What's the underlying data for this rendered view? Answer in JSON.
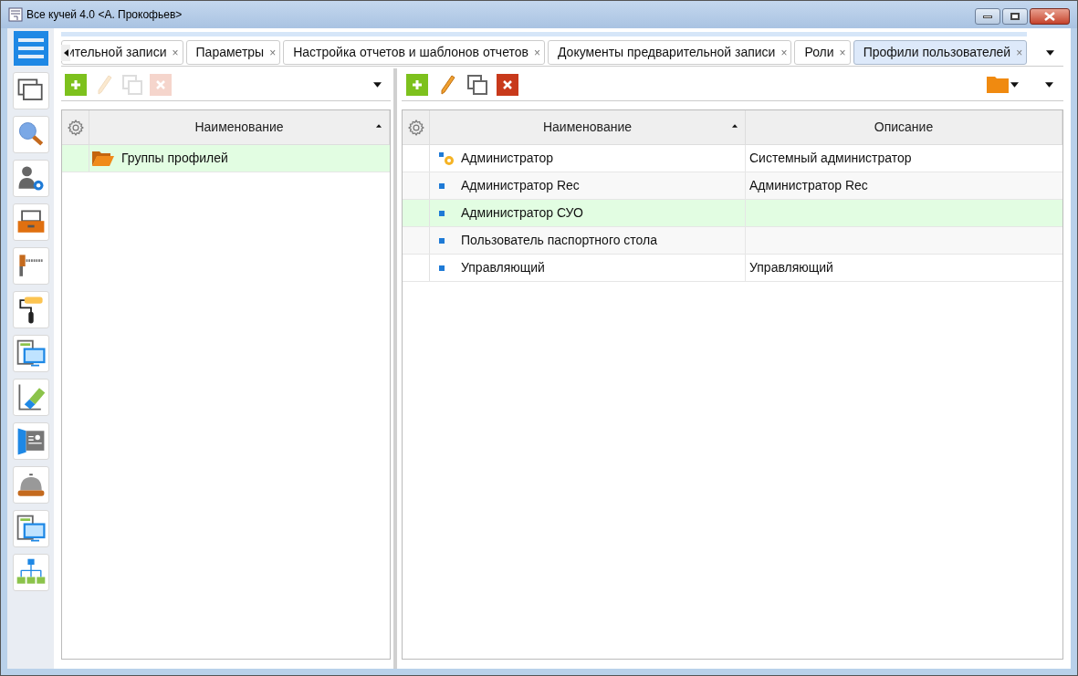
{
  "window": {
    "title": "Все кучей 4.0 <А. Прокофьев>"
  },
  "tabs": [
    {
      "label": "ительной записи",
      "selected": false
    },
    {
      "label": "Параметры",
      "selected": false
    },
    {
      "label": "Настройка отчетов и шаблонов отчетов",
      "selected": false
    },
    {
      "label": "Документы предварительной записи",
      "selected": false
    },
    {
      "label": "Роли",
      "selected": false
    },
    {
      "label": "Профили пользователей",
      "selected": true
    }
  ],
  "tab_close": "×",
  "left_panel": {
    "toolbar": [
      {
        "kind": "add",
        "disabled": false
      },
      {
        "kind": "edit",
        "disabled": true
      },
      {
        "kind": "copy",
        "disabled": true
      },
      {
        "kind": "delete",
        "disabled": true
      }
    ],
    "columns": [
      "Наименование"
    ],
    "rows": [
      {
        "name": "Группы профилей",
        "selected": true
      }
    ]
  },
  "right_panel": {
    "toolbar": [
      {
        "kind": "add",
        "disabled": false
      },
      {
        "kind": "edit",
        "disabled": false
      },
      {
        "kind": "copy",
        "disabled": false
      },
      {
        "kind": "delete",
        "disabled": false
      }
    ],
    "columns": [
      "Наименование",
      "Описание"
    ],
    "rows": [
      {
        "kind": "admin",
        "name": "Администратор",
        "description": "Системный администратор",
        "selected": false
      },
      {
        "kind": "user",
        "name": "Администратор Rec",
        "description": "Администратор Rec",
        "selected": false
      },
      {
        "kind": "user",
        "name": "Администратор СУО",
        "selected": true
      },
      {
        "kind": "user",
        "name": "Пользователь паспортного стола",
        "selected": false
      },
      {
        "kind": "user",
        "name": "Управляющий",
        "description": "Управляющий",
        "selected": false
      }
    ]
  }
}
